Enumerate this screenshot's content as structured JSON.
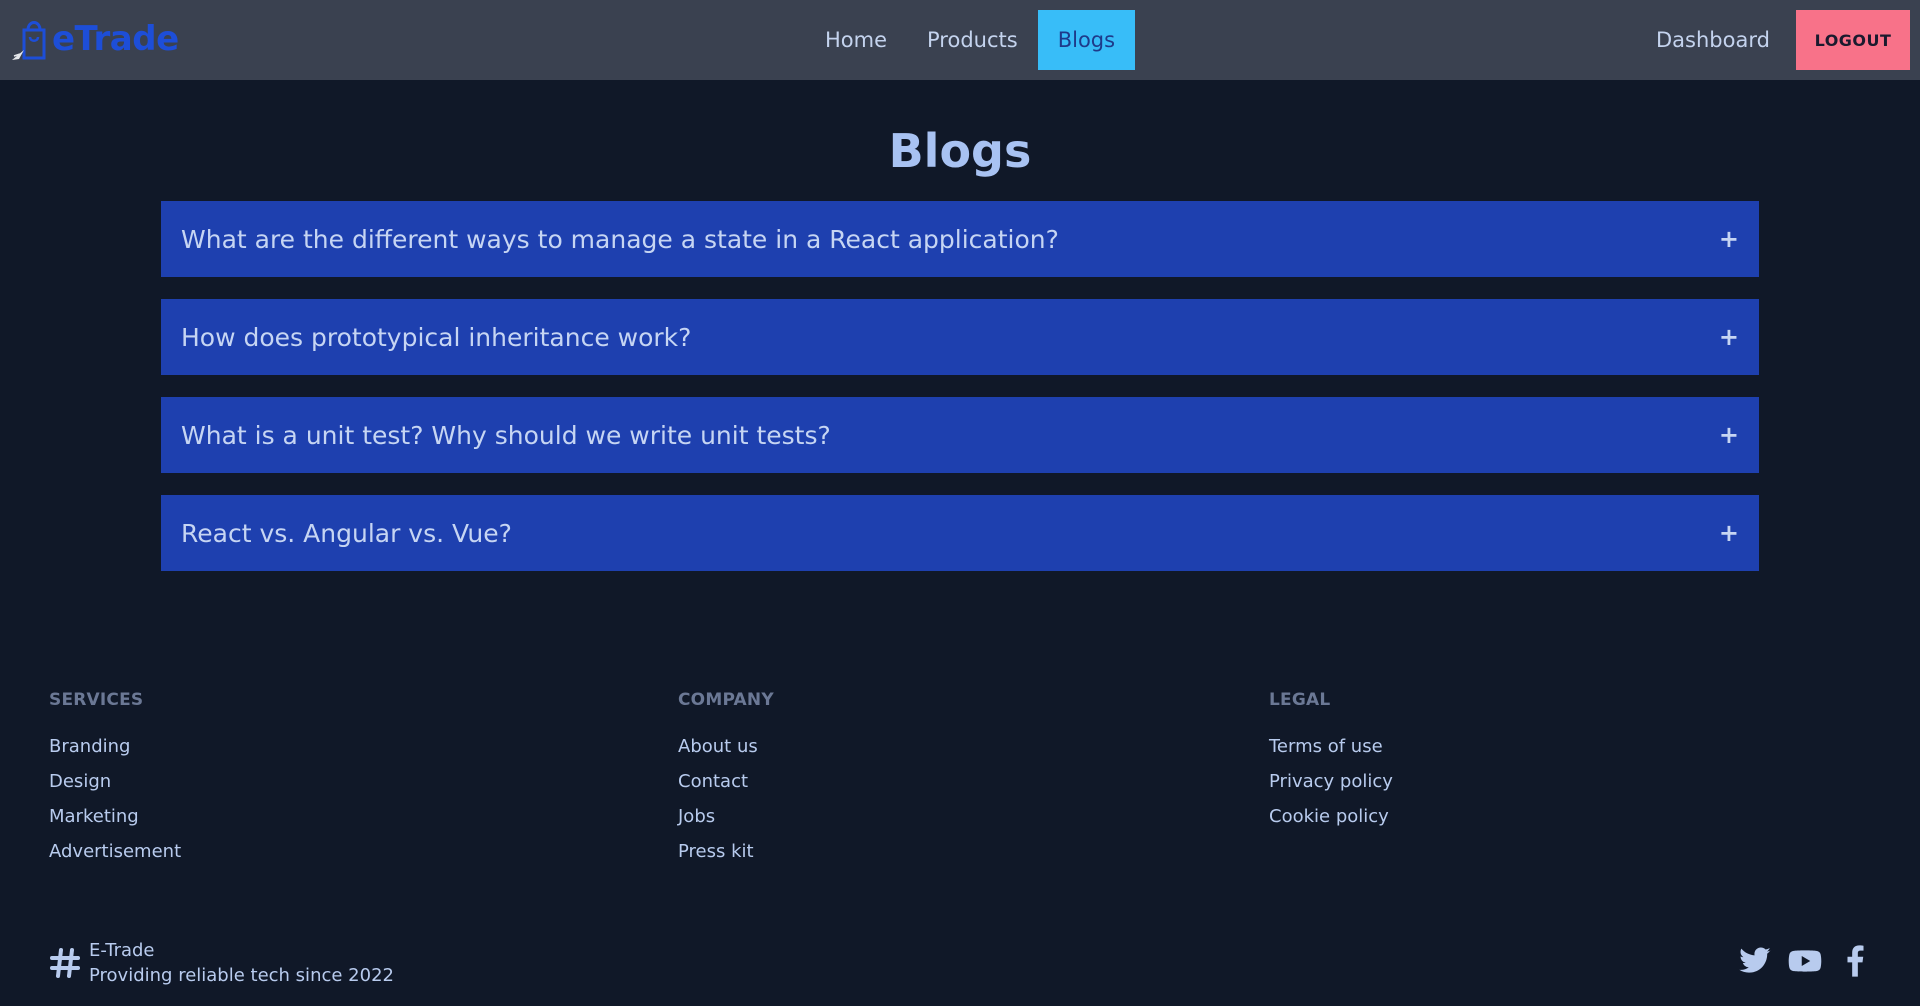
{
  "brand": {
    "logo_text": "eTrade"
  },
  "nav": {
    "links": [
      {
        "label": "Home"
      },
      {
        "label": "Products"
      },
      {
        "label": "Blogs"
      }
    ],
    "active": "Blogs",
    "dashboard_label": "Dashboard",
    "logout_label": "LOGOUT"
  },
  "main": {
    "title": "Blogs",
    "questions": [
      {
        "label": "What are the different ways to manage a state in a React application?"
      },
      {
        "label": "How does prototypical inheritance work?"
      },
      {
        "label": "What is a unit test? Why should we write unit tests?"
      },
      {
        "label": "React vs. Angular vs. Vue?"
      }
    ],
    "expand_symbol": "+"
  },
  "footer": {
    "services": {
      "title": "SERVICES",
      "links": [
        "Branding",
        "Design",
        "Marketing",
        "Advertisement"
      ]
    },
    "company": {
      "title": "COMPANY",
      "links": [
        "About us",
        "Contact",
        "Jobs",
        "Press kit"
      ]
    },
    "legal": {
      "title": "LEGAL",
      "links": [
        "Terms of use",
        "Privacy policy",
        "Cookie policy"
      ]
    },
    "brand_name": "E-Trade",
    "tagline": "Providing reliable tech since 2022",
    "socials": [
      "twitter-icon",
      "youtube-icon",
      "facebook-icon"
    ]
  },
  "colors": {
    "background": "#101828",
    "navbar": "#3a4150",
    "accent": "#38bdf8",
    "logout": "#f87289",
    "accordion": "#1e40af",
    "logo": "#1d4ed8"
  }
}
